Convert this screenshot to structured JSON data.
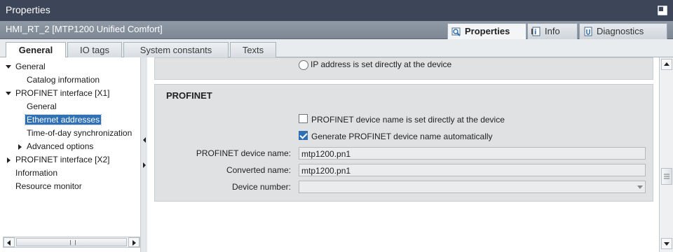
{
  "window": {
    "title": "Properties"
  },
  "object_bar": {
    "object_name": "HMI_RT_2 [MTP1200 Unified Comfort]",
    "inspector_tabs": [
      {
        "label": "Properties",
        "icon": "properties-icon",
        "active": true
      },
      {
        "label": "Info",
        "icon": "info-icon",
        "active": false
      },
      {
        "label": "Diagnostics",
        "icon": "diagnostics-icon",
        "active": false
      }
    ]
  },
  "tabs": [
    {
      "label": "General",
      "active": true
    },
    {
      "label": "IO tags",
      "active": false
    },
    {
      "label": "System constants",
      "active": false
    },
    {
      "label": "Texts",
      "active": false
    }
  ],
  "tree": {
    "items": [
      {
        "label": "General",
        "expander": "expanded"
      },
      {
        "label": "Catalog information",
        "expander": "none"
      },
      {
        "label": "PROFINET interface [X1]",
        "expander": "expanded"
      },
      {
        "label": "General",
        "expander": "none"
      },
      {
        "label": "Ethernet addresses",
        "expander": "none",
        "selected": true
      },
      {
        "label": "Time-of-day synchronization",
        "expander": "none"
      },
      {
        "label": "Advanced options",
        "expander": "collapsed"
      },
      {
        "label": "PROFINET interface [X2]",
        "expander": "collapsed"
      },
      {
        "label": "Information",
        "expander": "none"
      },
      {
        "label": "Resource monitor",
        "expander": "none"
      }
    ]
  },
  "ip_section": {
    "radio_label": "IP address is set directly at the device",
    "radio_selected": false
  },
  "profinet": {
    "heading": "PROFINET",
    "name_set_at_device": {
      "label": "PROFINET device name is set directly at the device",
      "checked": false
    },
    "generate_name": {
      "label": "Generate PROFINET device name automatically",
      "checked": true
    },
    "device_name": {
      "label": "PROFINET device name:",
      "value": "mtp1200.pn1"
    },
    "converted_name": {
      "label": "Converted name:",
      "value": "mtp1200.pn1"
    },
    "device_number": {
      "label": "Device number:",
      "value": ""
    }
  },
  "colors": {
    "title_bar": "#3c4658",
    "selection": "#2f6fb4",
    "panel": "#dfe1e3"
  }
}
